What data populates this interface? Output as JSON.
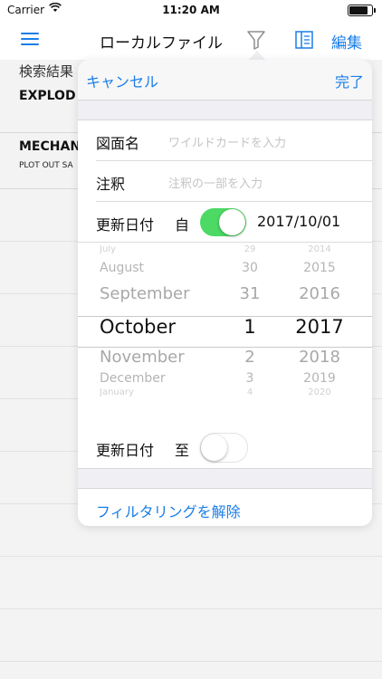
{
  "status_bar": {
    "carrier": "Carrier",
    "time": "11:20 AM"
  },
  "nav": {
    "title": "ローカルファイル",
    "edit_label": "編集",
    "icons": [
      "menu-icon",
      "filter-icon",
      "book-icon"
    ]
  },
  "background": {
    "header": "検索結果",
    "rows": [
      {
        "title": "EXPLOD"
      },
      {
        "title": "MECHAN",
        "subtitle": "PLOT OUT SA"
      }
    ]
  },
  "filter": {
    "cancel_label": "キャンセル",
    "done_label": "完了",
    "drawing_name": {
      "label": "図面名",
      "placeholder": "ワイルドカードを入力"
    },
    "annotation": {
      "label": "注釈",
      "placeholder": "注釈の一部を入力"
    },
    "date_from": {
      "label": "更新日付",
      "qualifier": "自",
      "enabled": true,
      "value": "2017/10/01"
    },
    "date_to": {
      "label": "更新日付",
      "qualifier": "至",
      "enabled": false
    },
    "picker": {
      "months": [
        "July",
        "August",
        "September",
        "October",
        "November",
        "December",
        "January"
      ],
      "days": [
        "29",
        "30",
        "31",
        "1",
        "2",
        "3",
        "4"
      ],
      "years": [
        "2014",
        "2015",
        "2016",
        "2017",
        "2018",
        "2019",
        "2020"
      ],
      "selected": {
        "month": "October",
        "day": "1",
        "year": "2017"
      }
    },
    "clear_label": "フィルタリングを解除"
  },
  "colors": {
    "accent": "#1a7ee8",
    "toggle_on": "#4cd964"
  }
}
